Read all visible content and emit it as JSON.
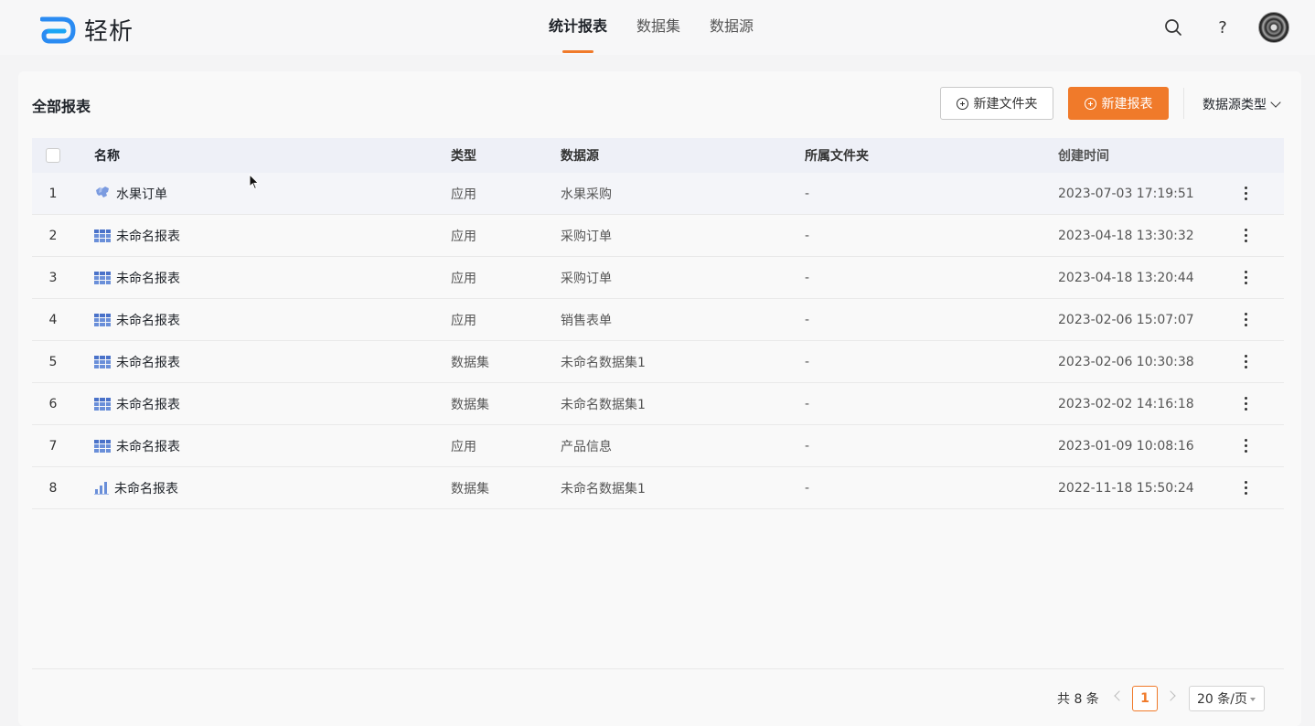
{
  "header": {
    "logo_text": "轻析",
    "nav": [
      {
        "label": "统计报表",
        "active": true
      },
      {
        "label": "数据集",
        "active": false
      },
      {
        "label": "数据源",
        "active": false
      }
    ],
    "help_label": "?"
  },
  "toolbar": {
    "title": "全部报表",
    "new_folder_label": "新建文件夹",
    "new_report_label": "新建报表",
    "filter_label": "数据源类型"
  },
  "table": {
    "columns": {
      "name": "名称",
      "type": "类型",
      "source": "数据源",
      "folder": "所属文件夹",
      "created": "创建时间"
    },
    "rows": [
      {
        "index": "1",
        "icon": "map-icon",
        "name": "水果订单",
        "type": "应用",
        "source": "水果采购",
        "folder": "-",
        "created": "2023-07-03 17:19:51"
      },
      {
        "index": "2",
        "icon": "table-icon",
        "name": "未命名报表",
        "type": "应用",
        "source": "采购订单",
        "folder": "-",
        "created": "2023-04-18 13:30:32"
      },
      {
        "index": "3",
        "icon": "table-icon",
        "name": "未命名报表",
        "type": "应用",
        "source": "采购订单",
        "folder": "-",
        "created": "2023-04-18 13:20:44"
      },
      {
        "index": "4",
        "icon": "table-icon",
        "name": "未命名报表",
        "type": "应用",
        "source": "销售表单",
        "folder": "-",
        "created": "2023-02-06 15:07:07"
      },
      {
        "index": "5",
        "icon": "table-icon",
        "name": "未命名报表",
        "type": "数据集",
        "source": "未命名数据集1",
        "folder": "-",
        "created": "2023-02-06 10:30:38"
      },
      {
        "index": "6",
        "icon": "table-icon",
        "name": "未命名报表",
        "type": "数据集",
        "source": "未命名数据集1",
        "folder": "-",
        "created": "2023-02-02 14:16:18"
      },
      {
        "index": "7",
        "icon": "table-icon",
        "name": "未命名报表",
        "type": "应用",
        "source": "产品信息",
        "folder": "-",
        "created": "2023-01-09 10:08:16"
      },
      {
        "index": "8",
        "icon": "bar-chart-icon",
        "name": "未命名报表",
        "type": "数据集",
        "source": "未命名数据集1",
        "folder": "-",
        "created": "2022-11-18 15:50:24"
      }
    ]
  },
  "pagination": {
    "total_label": "共 8 条",
    "current_page": "1",
    "page_size_label": "20 条/页"
  },
  "colors": {
    "accent": "#f07a2a",
    "icon_blue": "#6a8fd9",
    "header_row": "#eef0f7"
  }
}
